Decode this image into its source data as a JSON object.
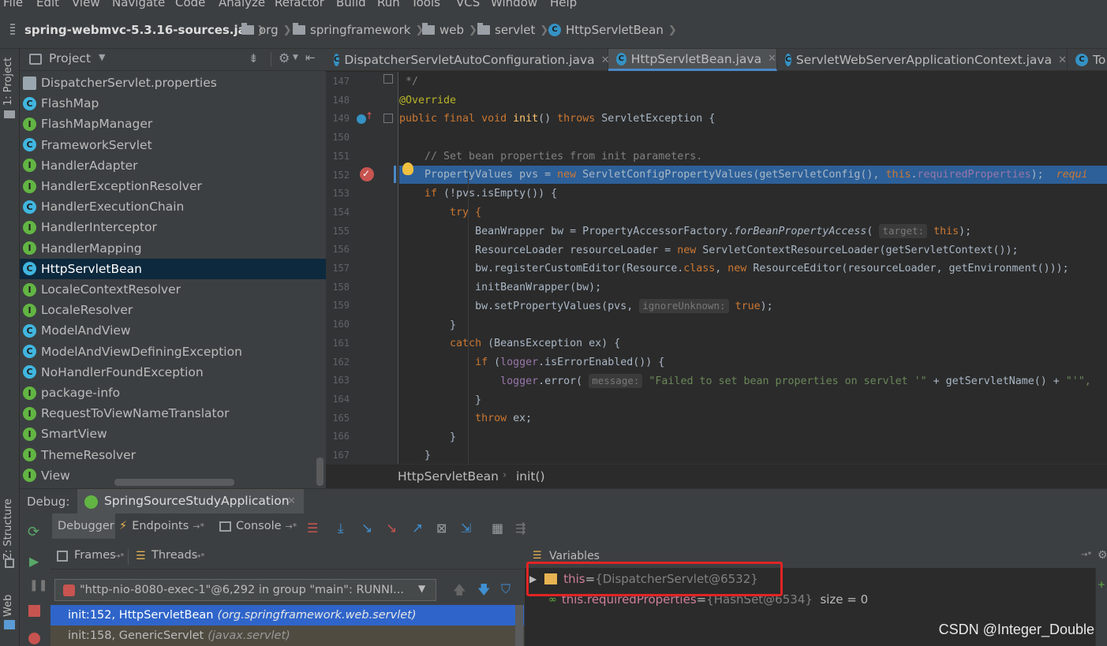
{
  "menu": [
    "File",
    "Edit",
    "View",
    "Navigate",
    "Code",
    "Analyze",
    "Refactor",
    "Build",
    "Run",
    "Tools",
    "VCS",
    "Window",
    "Help"
  ],
  "breadcrumb": {
    "jar": "spring-webmvc-5.3.16-sources.jar",
    "items": [
      "org",
      "springframework",
      "web",
      "servlet",
      "HttpServletBean"
    ]
  },
  "sidebar_tabs": {
    "project": "1: Project",
    "structure": "Z: Structure",
    "web": "Web"
  },
  "project": {
    "title": "Project",
    "items": [
      {
        "label": "DispatcherServlet.properties",
        "kind": "P"
      },
      {
        "label": "FlashMap",
        "kind": "C"
      },
      {
        "label": "FlashMapManager",
        "kind": "I"
      },
      {
        "label": "FrameworkServlet",
        "kind": "C"
      },
      {
        "label": "HandlerAdapter",
        "kind": "I"
      },
      {
        "label": "HandlerExceptionResolver",
        "kind": "I"
      },
      {
        "label": "HandlerExecutionChain",
        "kind": "C"
      },
      {
        "label": "HandlerInterceptor",
        "kind": "I"
      },
      {
        "label": "HandlerMapping",
        "kind": "I"
      },
      {
        "label": "HttpServletBean",
        "kind": "C",
        "selected": true
      },
      {
        "label": "LocaleContextResolver",
        "kind": "I"
      },
      {
        "label": "LocaleResolver",
        "kind": "I"
      },
      {
        "label": "ModelAndView",
        "kind": "C"
      },
      {
        "label": "ModelAndViewDefiningException",
        "kind": "C"
      },
      {
        "label": "NoHandlerFoundException",
        "kind": "C"
      },
      {
        "label": "package-info",
        "kind": "I"
      },
      {
        "label": "RequestToViewNameTranslator",
        "kind": "I"
      },
      {
        "label": "SmartView",
        "kind": "I"
      },
      {
        "label": "ThemeResolver",
        "kind": "I"
      },
      {
        "label": "View",
        "kind": "I"
      }
    ]
  },
  "editor": {
    "tabs": [
      {
        "label": "DispatcherServletAutoConfiguration.java"
      },
      {
        "label": "HttpServletBean.java",
        "active": true
      },
      {
        "label": "ServletWebServerApplicationContext.java"
      },
      {
        "label": "To"
      }
    ],
    "line_numbers": [
      "147",
      "148",
      "149",
      "150",
      "151",
      "152",
      "153",
      "154",
      "155",
      "156",
      "157",
      "158",
      "159",
      "160",
      "161",
      "162",
      "163",
      "164",
      "165",
      "166",
      "167"
    ],
    "code": {
      "l147": " */",
      "l148": "@Override",
      "l149_kw": "public final void ",
      "l149_fn": "init",
      "l149_a": "() ",
      "l149_throws": "throws",
      "l149_b": " ServletException {",
      "l151": "    // Set bean properties from init parameters.",
      "l152_a": "    PropertyValues pvs = ",
      "l152_new": "new",
      "l152_b": " ServletConfigPropertyValues(getServletConfig(), ",
      "l152_this": "this",
      "l152_dot": ".",
      "l152_field": "requiredProperties",
      "l152_end": ");  ",
      "l152_inlay": "requi",
      "l153_if": "    if",
      "l153_b": " (!pvs.isEmpty()) {",
      "l154": "        try {",
      "l155_a": "            BeanWrapper bw = PropertyAccessorFactory.",
      "l155_m": "forBeanPropertyAccess",
      "l155_b": "( ",
      "l155_hint": "target:",
      "l155_this": " this",
      "l155_end": ");",
      "l156_a": "            ResourceLoader resourceLoader = ",
      "l156_new": "new",
      "l156_b": " ServletContextResourceLoader(getServletContext());",
      "l157_a": "            bw.registerCustomEditor(Resource.",
      "l157_class": "class",
      "l157_comma": ", ",
      "l157_new": "new",
      "l157_b": " ResourceEditor(resourceLoader, getEnvironment()));",
      "l158": "            initBeanWrapper(bw);",
      "l159_a": "            bw.setPropertyValues(pvs, ",
      "l159_hint": "ignoreUnknown:",
      "l159_true": " true",
      "l159_end": ");",
      "l160": "        }",
      "l161_catch": "        catch",
      "l161_b": " (BeansException ex) {",
      "l162_if": "            if",
      "l162_a": " (",
      "l162_logger": "logger",
      "l162_b": ".isErrorEnabled()) {",
      "l163_pad": "                ",
      "l163_logger": "logger",
      "l163_a": ".error( ",
      "l163_hint": "message:",
      "l163_str": " \"Failed to set bean properties on servlet '\"",
      "l163_b": " + getServletName() + ",
      "l163_str2": "\"'\",",
      "l164": "            }",
      "l165_throw": "            throw",
      "l165_b": " ex;",
      "l166": "        }",
      "l167": "    }"
    },
    "bottom_breadcrumb": {
      "class": "HttpServletBean",
      "method": "init()"
    }
  },
  "debug": {
    "label": "Debug:",
    "session": "SpringSourceStudyApplication",
    "tabs": [
      "Debugger",
      "Endpoints",
      "Console"
    ],
    "frames_tab": "Frames",
    "threads_tab": "Threads",
    "thread_combo": "\"http-nio-8080-exec-1\"@6,292 in group \"main\": RUNNI...",
    "frames": [
      {
        "method": "init:152, HttpServletBean",
        "pkg": "(org.springframework.web.servlet)",
        "selected": true
      },
      {
        "method": "init:158, GenericServlet",
        "pkg": "(javax.servlet)"
      }
    ],
    "variables_title": "Variables",
    "variables": [
      {
        "name": "this",
        "eq": " = ",
        "value": "{DispatcherServlet@6532}"
      },
      {
        "name": "this.requiredProperties",
        "eq": " = ",
        "value": "{HashSet@6534}",
        "extra": "  size = 0"
      }
    ]
  },
  "watermark": "CSDN @Integer_Double",
  "colors": {
    "selection": "#0d293e",
    "exec_line": "#2d6099",
    "highlight_box": "#e02424",
    "keyword": "#cc7832"
  }
}
